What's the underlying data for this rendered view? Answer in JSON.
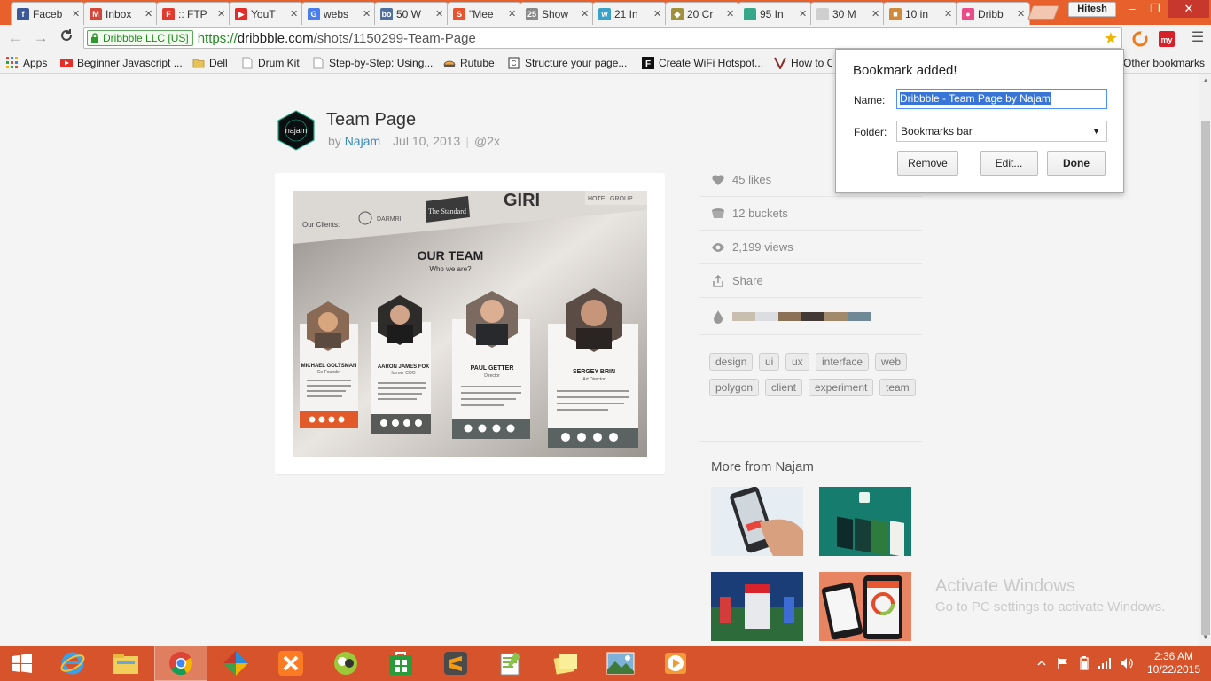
{
  "browser": {
    "tabs": [
      {
        "label": "Faceb",
        "color": "#3b5998",
        "glyph": "f"
      },
      {
        "label": "Inbox",
        "color": "#d44638",
        "glyph": "M"
      },
      {
        "label": ":: FTP",
        "color": "#e03b2e",
        "glyph": "F"
      },
      {
        "label": "YouT",
        "color": "#e52d27",
        "glyph": "▶"
      },
      {
        "label": "webs",
        "color": "#4a7ef0",
        "glyph": "G"
      },
      {
        "label": "50 W",
        "color": "#4f6f9f",
        "glyph": "bo"
      },
      {
        "label": "\"Mee",
        "color": "#e8542f",
        "glyph": "S"
      },
      {
        "label": "Show",
        "color": "#8a8a8a",
        "glyph": "25"
      },
      {
        "label": "21 In",
        "color": "#3aa2c9",
        "glyph": "w"
      },
      {
        "label": "20 Cr",
        "color": "#a1913c",
        "glyph": "◆"
      },
      {
        "label": "95 In",
        "color": "#36a88a",
        "glyph": ""
      },
      {
        "label": "30 M",
        "color": "#cfcfcf",
        "glyph": ""
      },
      {
        "label": "10 in",
        "color": "#d08a3b",
        "glyph": "■"
      },
      {
        "label": "Dribb",
        "color": "#ea4c89",
        "glyph": "●"
      }
    ],
    "profile_name": "Hitesh",
    "window_controls": {
      "minimize": "–",
      "maximize": "❐",
      "close": "✕"
    },
    "security_badge": "Dribbble LLC [US]",
    "url_scheme": "https://",
    "url_host": "dribbble.com",
    "url_path": "/shots/1150299-Team-Page"
  },
  "bookmarks": [
    {
      "label": "Apps"
    },
    {
      "label": "Beginner Javascript ..."
    },
    {
      "label": "Dell"
    },
    {
      "label": "Drum Kit"
    },
    {
      "label": "Step-by-Step: Using..."
    },
    {
      "label": "Rutube"
    },
    {
      "label": "Structure your page..."
    },
    {
      "label": "Create WiFi Hotspot..."
    },
    {
      "label": "How to C"
    },
    {
      "label": "Other bookmarks"
    }
  ],
  "shot": {
    "title": "Team Page",
    "by": "by",
    "author": "Najam",
    "date": "Jul 10, 2013",
    "divider": "|",
    "retina": "@2x",
    "image": {
      "clients_label": "Our Clients:",
      "client_1": "DARMRI",
      "client_2": "The Standard",
      "client_3": "GIRI",
      "client_4": "HOTEL GROUP",
      "heading": "OUR TEAM",
      "subheading": "Who we are?",
      "members": [
        {
          "name": "MICHAEL GOLTSMAN",
          "role": "Co-Founder"
        },
        {
          "name": "AARON JAMES FOX",
          "role": "former COO"
        },
        {
          "name": "PAUL GETTER",
          "role": "Director"
        },
        {
          "name": "SERGEY BRIN",
          "role": "Art Director"
        }
      ]
    }
  },
  "stats": {
    "likes": "45 likes",
    "buckets": "12 buckets",
    "views": "2,199 views",
    "share": "Share",
    "palette": [
      "#c8bfae",
      "#dcdde0",
      "#8c7156",
      "#433934",
      "#a18a6c",
      "#6f8a96"
    ]
  },
  "tags": [
    "design",
    "ui",
    "ux",
    "interface",
    "web",
    "polygon",
    "client",
    "experiment",
    "team"
  ],
  "more": {
    "title": "More from Najam"
  },
  "watermark": {
    "line1": "Activate Windows",
    "line2": "Go to PC settings to activate Windows."
  },
  "bookmark_popup": {
    "title": "Bookmark added!",
    "name_label": "Name:",
    "name_value": "Dribbble - Team Page by Najam",
    "folder_label": "Folder:",
    "folder_value": "Bookmarks bar",
    "remove_label": "Remove",
    "edit_label": "Edit...",
    "done_label": "Done"
  },
  "taskbar": {
    "time": "2:36 AM",
    "date": "10/22/2015"
  }
}
